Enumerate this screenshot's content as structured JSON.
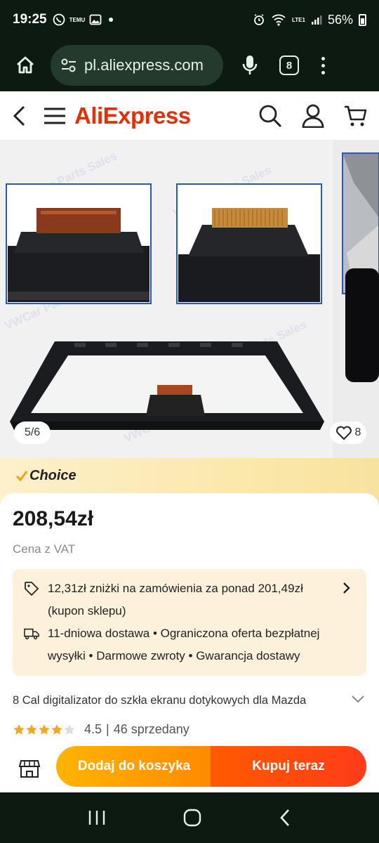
{
  "status_bar": {
    "time": "19:25",
    "temu_label": "TEMU",
    "network_label": "LTE1",
    "battery": "56%"
  },
  "browser": {
    "url": "pl.aliexpress.com",
    "tab_count": "8"
  },
  "site": {
    "logo": "AliExpress"
  },
  "gallery": {
    "counter": "5/6",
    "likes": "8",
    "watermark": "VWCar Parts Sales"
  },
  "choice": {
    "label": "Choice"
  },
  "product": {
    "price": "208,54zł",
    "vat_note": "Cena z VAT",
    "coupon_text": "12,31zł zniżki na zamówienia za ponad 201,49zł (kupon sklepu)",
    "delivery_text": "11-dniowa dostawa • Ograniczona oferta bezpłatnej wysyłki • Darmowe zwroty • Gwarancja dostawy",
    "title": "8 Cal digitalizator do szkła ekranu dotykowych dla Mazda",
    "rating": "4.5",
    "separator": "|",
    "sold": "46 sprzedany",
    "star_rating": 4.5
  },
  "actions": {
    "add_to_cart": "Dodaj do koszyka",
    "buy_now": "Kupuj teraz"
  },
  "colors": {
    "brand": "#e62e04",
    "cart_button": "#ff9a00",
    "buy_button": "#ff4a10",
    "promo_bg": "#fdf1dc",
    "system_bar": "#0c1a12"
  }
}
